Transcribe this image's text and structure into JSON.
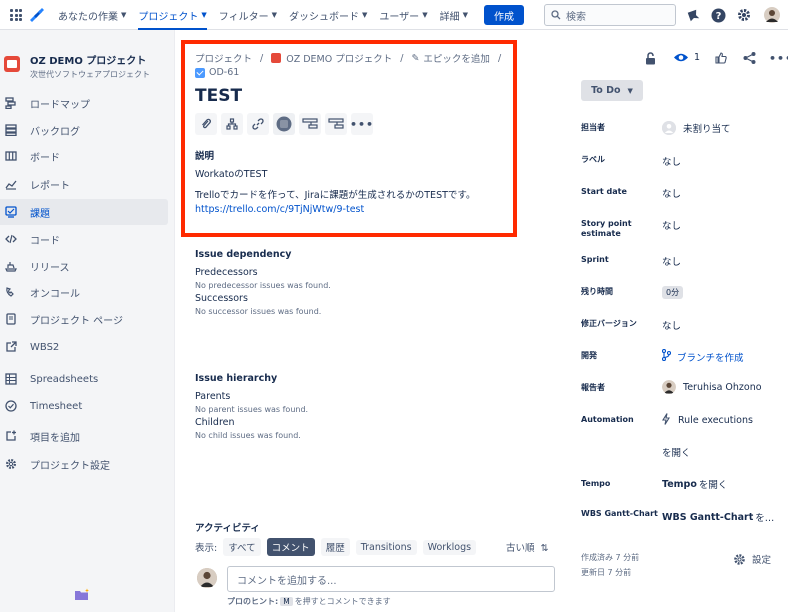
{
  "nav": {
    "items": [
      {
        "label": "あなたの作業",
        "active": false
      },
      {
        "label": "プロジェクト",
        "active": true
      },
      {
        "label": "フィルター",
        "active": false
      },
      {
        "label": "ダッシュボード",
        "active": false
      },
      {
        "label": "ユーザー",
        "active": false
      },
      {
        "label": "詳細",
        "active": false
      }
    ],
    "create_label": "作成",
    "search_placeholder": "検索"
  },
  "sidebar": {
    "project_name": "OZ DEMO プロジェクト",
    "project_type": "次世代ソフトウェアプロジェクト",
    "items": [
      {
        "label": "ロードマップ",
        "icon": "roadmap-icon"
      },
      {
        "label": "バックログ",
        "icon": "backlog-icon"
      },
      {
        "label": "ボード",
        "icon": "board-icon"
      },
      {
        "label": "レポート",
        "icon": "reports-icon"
      },
      {
        "label": "課題",
        "icon": "issues-icon",
        "active": true
      },
      {
        "label": "コード",
        "icon": "code-icon"
      },
      {
        "label": "リリース",
        "icon": "release-icon"
      },
      {
        "label": "オンコール",
        "icon": "on-call-icon"
      },
      {
        "label": "プロジェクト ページ",
        "icon": "project-pages-icon"
      },
      {
        "label": "WBS2",
        "icon": "external-link-icon"
      },
      {
        "label": "Spreadsheets",
        "icon": "spreadsheet-icon"
      },
      {
        "label": "Timesheet",
        "icon": "timesheet-icon"
      },
      {
        "label": "項目を追加",
        "icon": "add-item-icon"
      },
      {
        "label": "プロジェクト設定",
        "icon": "gear-icon"
      }
    ]
  },
  "issue": {
    "breadcrumb": [
      "プロジェクト",
      "OZ DEMO プロジェクト",
      "エピックを追加"
    ],
    "key": "OD-61",
    "title": "TEST",
    "description_label": "説明",
    "description_lines": [
      "WorkatoのTEST",
      "Trelloでカードを作って、Jiraに課題が生成されるかのTESTです。"
    ],
    "description_link": "https://trello.com/c/9TjNjWtw/9-test"
  },
  "dependency": {
    "title": "Issue dependency",
    "predecessors_label": "Predecessors",
    "predecessors_note": "No predecessor issues was found.",
    "successors_label": "Successors",
    "successors_note": "No successor issues was found."
  },
  "hierarchy": {
    "title": "Issue hierarchy",
    "parents_label": "Parents",
    "parents_note": "No parent issues was found.",
    "children_label": "Children",
    "children_note": "No child issues was found."
  },
  "activity": {
    "title": "アクティビティ",
    "show_label": "表示:",
    "filters": [
      {
        "label": "すべて",
        "selected": false
      },
      {
        "label": "コメント",
        "selected": true
      },
      {
        "label": "履歴",
        "selected": false
      },
      {
        "label": "Transitions",
        "selected": false
      },
      {
        "label": "Worklogs",
        "selected": false
      }
    ],
    "sort_label": "古い順",
    "comment_placeholder": "コメントを追加する...",
    "tip_prefix": "プロのヒント:",
    "tip_key": "M",
    "tip_suffix": "を押すとコメントできます"
  },
  "right": {
    "watch_count": "1",
    "status": "To Do",
    "fields": [
      {
        "label": "担当者",
        "value": "未割り当て",
        "type": "assignee"
      },
      {
        "label": "ラベル",
        "value": "なし"
      },
      {
        "label": "Start date",
        "value": "なし"
      },
      {
        "label": "Story point estimate",
        "value": "なし"
      },
      {
        "label": "Sprint",
        "value": "なし"
      },
      {
        "label": "残り時間",
        "value": "0分",
        "type": "pill"
      },
      {
        "label": "修正バージョン",
        "value": "なし"
      },
      {
        "label": "開発",
        "value": "ブランチを作成",
        "type": "branch"
      },
      {
        "label": "報告者",
        "value": "Teruhisa Ohzono",
        "type": "reporter"
      },
      {
        "label": "Automation",
        "value": "Rule executions",
        "type": "automation"
      },
      {
        "label": "",
        "value": "を開く"
      },
      {
        "label": "Tempo",
        "value_bold": "Tempo",
        "value": "を開く",
        "type": "tempo"
      },
      {
        "label": "WBS Gantt-Chart",
        "value_bold": "WBS Gantt-Chart",
        "value": "を…",
        "type": "wbs"
      }
    ],
    "created": "作成済み 7 分前",
    "updated": "更新日 7 分前",
    "settings_label": "設定"
  },
  "colors": {
    "accent": "#0052cc",
    "highlight": "#ff2a00",
    "project": "#e5493a"
  }
}
